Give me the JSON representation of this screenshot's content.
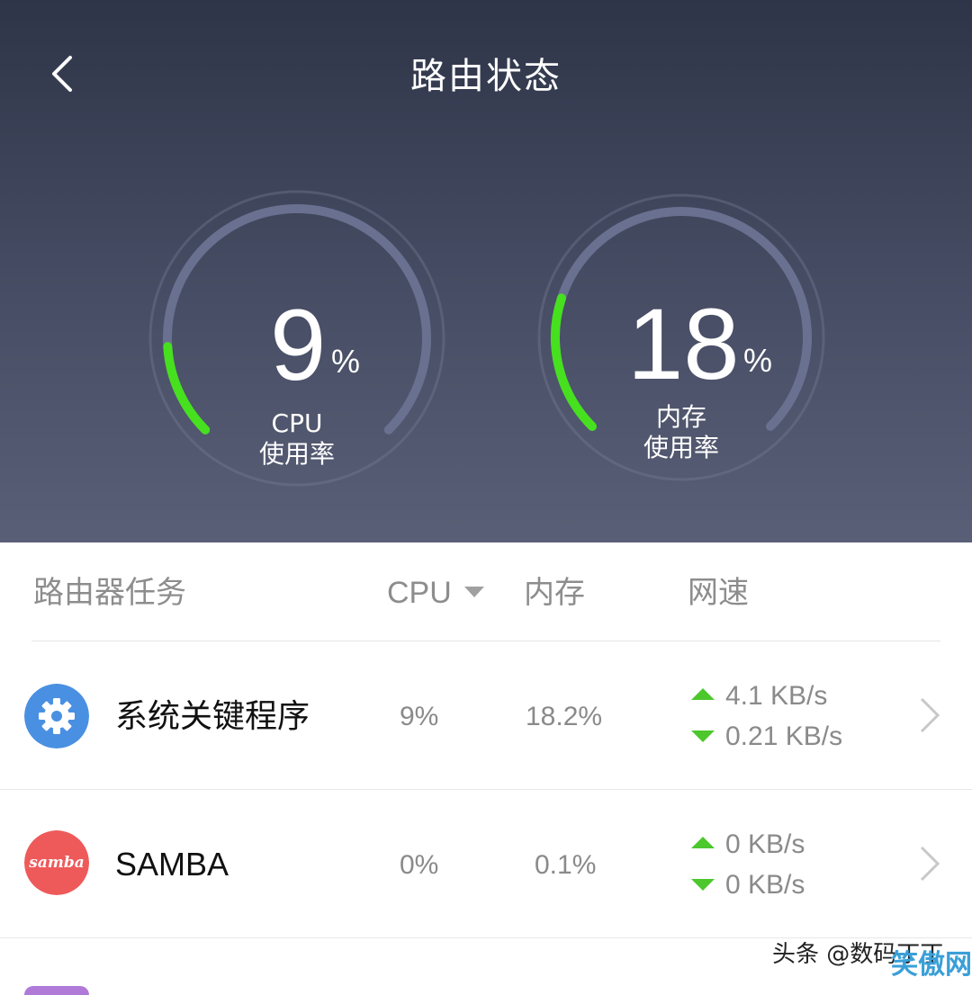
{
  "header": {
    "title": "路由状态",
    "background_top": "#2f3548",
    "background_bottom": "#595f76"
  },
  "gauges": {
    "cpu": {
      "value": "9",
      "unit": "%",
      "label_line1": "CPU",
      "label_line2": "使用率",
      "fraction": 0.09
    },
    "memory": {
      "value": "18",
      "unit": "%",
      "label_line1": "内存",
      "label_line2": "使用率",
      "fraction": 0.18
    },
    "accent_color": "#46e01f",
    "track_color": "#6a7090"
  },
  "table": {
    "columns": {
      "task": "路由器任务",
      "cpu": "CPU",
      "memory": "内存",
      "speed": "网速"
    },
    "sort_icon": "triangle-down-icon",
    "rows": [
      {
        "icon": "gear-icon",
        "icon_color": "#4a90e2",
        "name": "系统关键程序",
        "cpu": "9%",
        "memory": "18.2%",
        "upload": "4.1 KB/s",
        "download": "0.21 KB/s"
      },
      {
        "icon": "samba-logo-icon",
        "icon_color": "#ee5a5a",
        "icon_text": "samba",
        "name": "SAMBA",
        "cpu": "0%",
        "memory": "0.1%",
        "upload": "0 KB/s",
        "download": "0 KB/s"
      }
    ]
  },
  "speed_arrow_color": "#4cc72c",
  "watermark": {
    "text": "头条 @数码丁丁",
    "logo_text": "笑傲网"
  }
}
